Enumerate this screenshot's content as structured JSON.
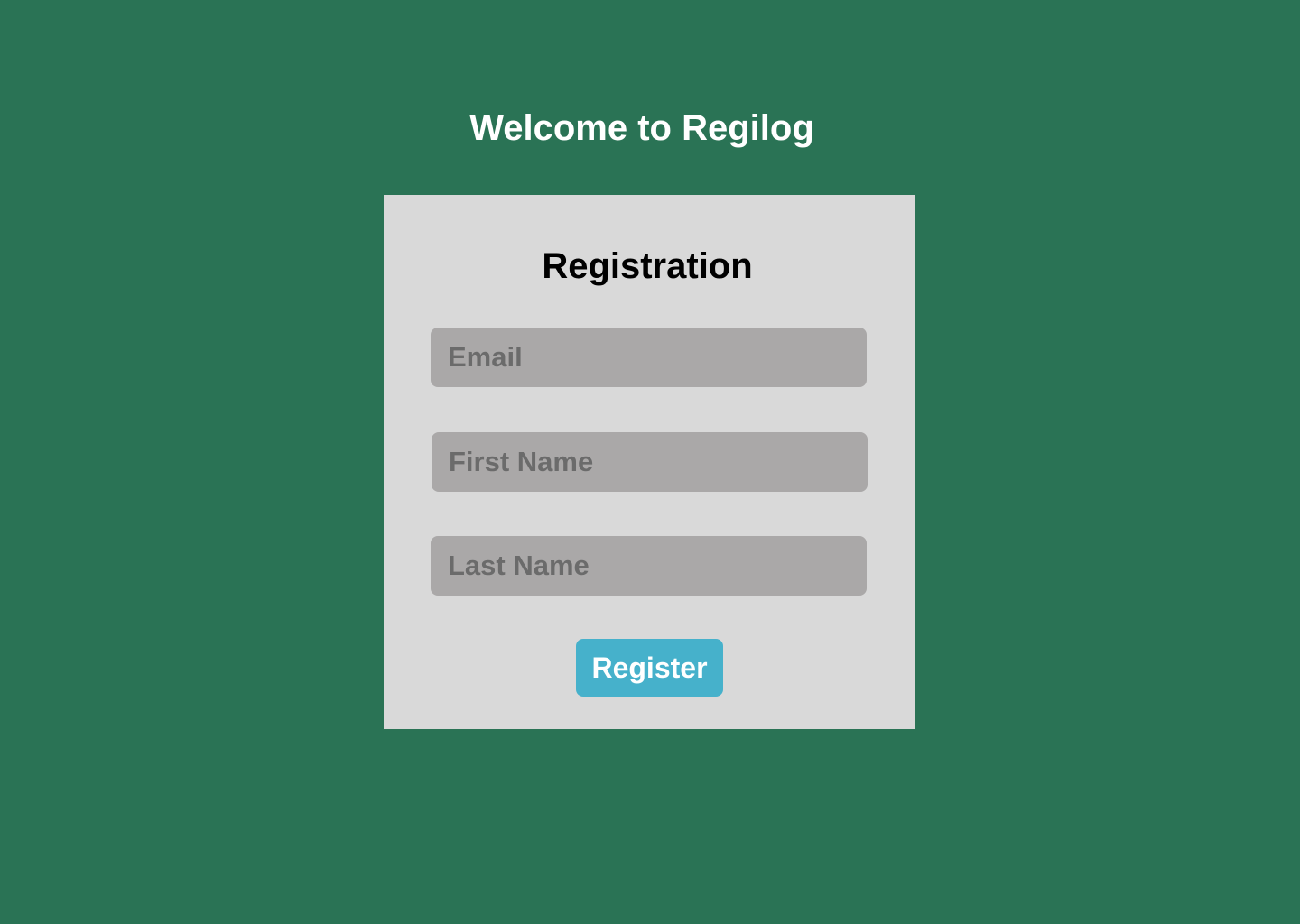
{
  "page": {
    "welcome_title": "Welcome to Regilog",
    "background_color": "#2a7355"
  },
  "form": {
    "title": "Registration",
    "fields": {
      "email": {
        "placeholder": "Email",
        "value": ""
      },
      "first_name": {
        "placeholder": "First Name",
        "value": ""
      },
      "last_name": {
        "placeholder": "Last Name",
        "value": ""
      }
    },
    "submit_label": "Register",
    "colors": {
      "card": "#d9d9d9",
      "field": "#aaa8a8",
      "button": "#46b1cb"
    }
  }
}
